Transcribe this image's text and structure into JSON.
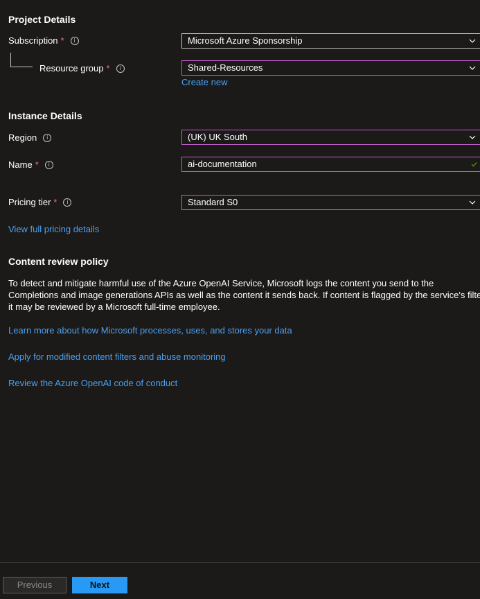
{
  "project": {
    "title": "Project Details",
    "subscription": {
      "label": "Subscription",
      "required": "*",
      "value": "Microsoft Azure Sponsorship"
    },
    "resource_group": {
      "label": "Resource group",
      "required": "*",
      "value": "Shared-Resources",
      "create_new": "Create new"
    }
  },
  "instance": {
    "title": "Instance Details",
    "region": {
      "label": "Region",
      "value": "(UK) UK South"
    },
    "name": {
      "label": "Name",
      "required": "*",
      "value": "ai-documentation"
    },
    "pricing": {
      "label": "Pricing tier",
      "required": "*",
      "value": "Standard S0"
    },
    "pricing_link": "View full pricing details"
  },
  "policy": {
    "title": "Content review policy",
    "text_lines": [
      "To detect and mitigate harmful use of the Azure OpenAI Service, Microsoft logs the content you send to the",
      "Completions and image generations APIs as well as the content it sends back. If content is flagged by the service's filters,",
      "it may be reviewed by a Microsoft full-time employee."
    ],
    "links": [
      "Learn more about how Microsoft processes, uses, and stores your data",
      "Apply for modified content filters and abuse monitoring",
      "Review the Azure OpenAI code of conduct"
    ]
  },
  "footer": {
    "previous": "Previous",
    "next": "Next"
  },
  "icons": {
    "info": "info-icon",
    "dropdown": "chevron-down-icon",
    "valid": "checkmark-icon"
  },
  "colors": {
    "background": "#1b1a19",
    "link": "#4aa0f0",
    "required": "#f1707b",
    "focus_border": "#c85fd0",
    "primary_button": "#2899f5",
    "valid": "#57a300"
  }
}
